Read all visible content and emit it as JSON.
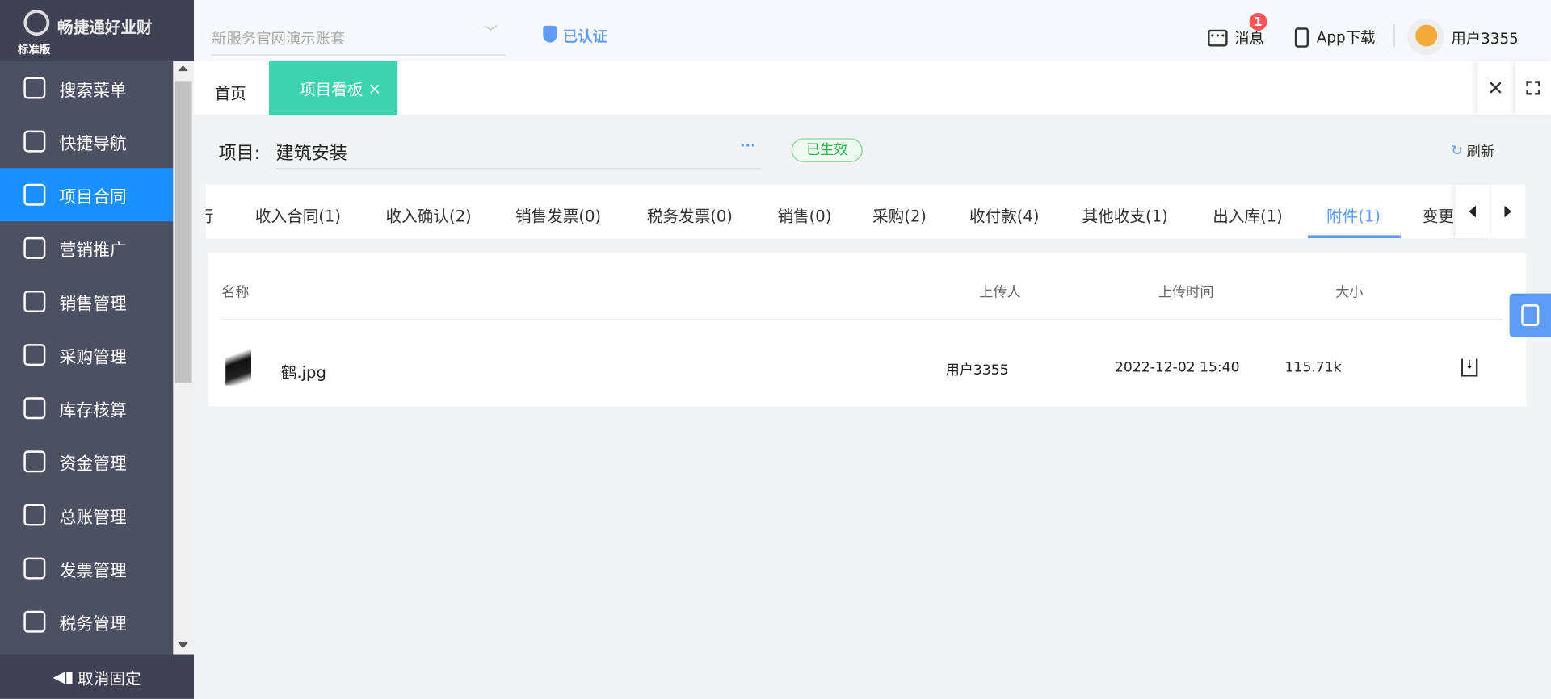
{
  "brand": {
    "name": "畅捷通好业财",
    "edition": "标准版"
  },
  "sidebar": {
    "items": [
      {
        "label": "搜索菜单",
        "icon": "search-menu-icon"
      },
      {
        "label": "快捷导航",
        "icon": "home-icon"
      },
      {
        "label": "项目合同",
        "icon": "contract-icon",
        "active": true
      },
      {
        "label": "营销推广",
        "icon": "gift-icon"
      },
      {
        "label": "销售管理",
        "icon": "sales-icon"
      },
      {
        "label": "采购管理",
        "icon": "bag-icon"
      },
      {
        "label": "库存核算",
        "icon": "warehouse-icon"
      },
      {
        "label": "资金管理",
        "icon": "money-bag-icon"
      },
      {
        "label": "总账管理",
        "icon": "ledger-icon"
      },
      {
        "label": "发票管理",
        "icon": "invoice-icon"
      },
      {
        "label": "税务管理",
        "icon": "tax-icon"
      }
    ],
    "unpin": "取消固定"
  },
  "header": {
    "account": "新服务官网演示账套",
    "verified": "已认证",
    "messages": "消息",
    "message_count": "1",
    "app_download": "App下载",
    "user": "用户3355"
  },
  "tabs": [
    {
      "label": "首页"
    },
    {
      "label": "项目看板",
      "active": true,
      "close": "×"
    }
  ],
  "project": {
    "label": "项目:",
    "value": "建筑安装",
    "more": "···",
    "status": "已生效",
    "refresh": "刷新"
  },
  "subtabs": [
    "行",
    "收入合同(1)",
    "收入确认(2)",
    "销售发票(0)",
    "税务发票(0)",
    "销售(0)",
    "采购(2)",
    "收付款(4)",
    "其他收支(1)",
    "出入库(1)",
    "附件(1)",
    "变更"
  ],
  "active_subtab": "附件(1)",
  "table": {
    "headers": [
      "名称",
      "上传人",
      "上传时间",
      "大小"
    ],
    "rows": [
      {
        "name": "鹤.jpg",
        "uploader": "用户3355",
        "time": "2022-12-02 15:40",
        "size": "115.71k"
      }
    ]
  },
  "colors": {
    "accent": "#1a90ff",
    "tab_active": "#3bd4ae",
    "sidebar": "#4b5062",
    "status": "#2bb34a"
  }
}
